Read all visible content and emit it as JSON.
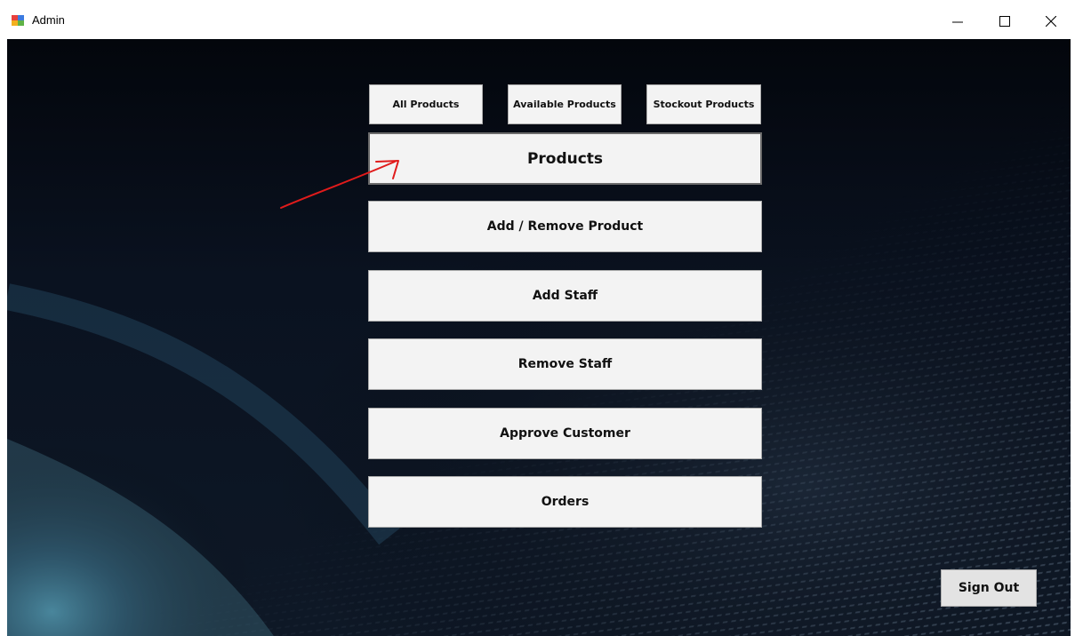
{
  "window": {
    "title": "Admin"
  },
  "tabs": {
    "all_products": "All Products",
    "available_products": "Available Products",
    "stockout_products": "Stockout Products"
  },
  "menu": {
    "products": "Products",
    "add_remove_product": "Add / Remove Product",
    "add_staff": "Add Staff",
    "remove_staff": "Remove Staff",
    "approve_customer": "Approve Customer",
    "orders": "Orders"
  },
  "footer": {
    "sign_out": "Sign Out"
  },
  "colors": {
    "button_bg": "#f3f3f3",
    "background": "#05080f",
    "annotation": "#e01b1b"
  }
}
